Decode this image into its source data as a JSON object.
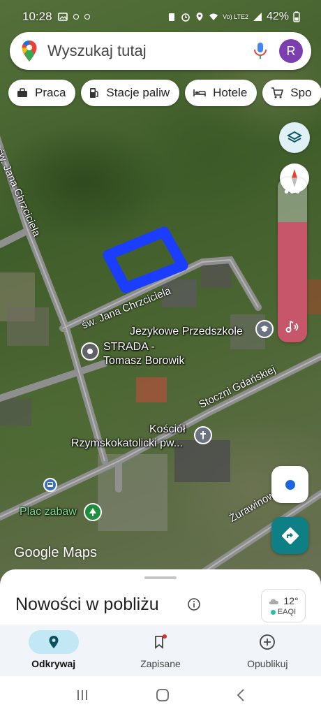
{
  "status_bar": {
    "time": "10:28",
    "network": "Vo) LTE2",
    "battery": "42%"
  },
  "search": {
    "placeholder": "Wyszukaj tutaj",
    "avatar_letter": "R"
  },
  "chips": [
    {
      "label": "Praca",
      "icon": "briefcase-icon"
    },
    {
      "label": "Stacje paliw",
      "icon": "fuel-icon"
    },
    {
      "label": "Hotele",
      "icon": "bed-icon"
    },
    {
      "label": "Spo",
      "icon": "cart-icon"
    }
  ],
  "map": {
    "street_labels": {
      "jana_vertical": "św. Jana Chrzciciela",
      "jana_diag": "św. Jana Chrzciciela",
      "stoczni": "Stoczni Gdańskiej",
      "zurawinowa": "Żurawinowa"
    },
    "pois": {
      "przedszkole": "Jezykowe Przedszkole",
      "strada_line1": "STRADA -",
      "strada_line2": "Tomasz Borowik",
      "kosciol_line1": "Kościół",
      "kosciol_line2": "Rzymskokatolicki pw...",
      "plac": "Plac zabaw"
    },
    "annotation_color": "#1a3dff",
    "attribution_google": "Google",
    "attribution_maps": "Maps"
  },
  "controls": {
    "music_dots": "•••"
  },
  "sheet": {
    "title": "Nowości w pobliżu",
    "weather_temp": "12°",
    "weather_aqi": "EAQI"
  },
  "nav": {
    "items": [
      {
        "label": "Odkrywaj",
        "icon": "location-pin-icon",
        "active": true
      },
      {
        "label": "Zapisane",
        "icon": "bookmark-icon",
        "active": false
      },
      {
        "label": "Opublikuj",
        "icon": "add-circle-icon",
        "active": false
      }
    ]
  },
  "colors": {
    "accent": "#0f7f86",
    "avatar": "#7b3fb0",
    "music": "#c7566a",
    "nav_active": "#c2e7f5"
  }
}
